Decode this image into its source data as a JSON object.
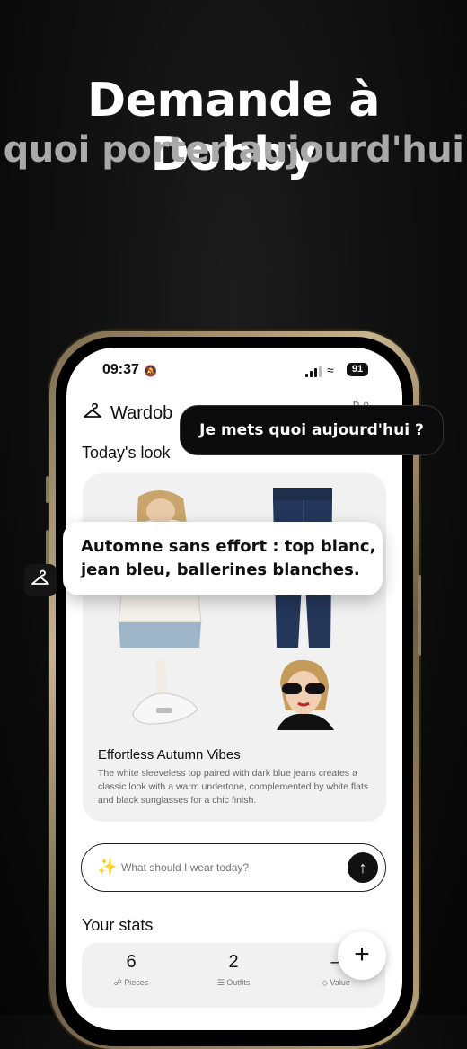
{
  "hero": {
    "title": "Demande à Dobby",
    "subtitle": "quoi porter aujourd'hui"
  },
  "status_bar": {
    "time": "09:37",
    "battery": "91"
  },
  "app": {
    "brand": "Wardob",
    "header_right": "₿ 0 ₀₀"
  },
  "todays_look": {
    "section_title": "Today's look",
    "title": "Effortless Autumn Vibes",
    "description": "The white sleeveless top paired with dark blue jeans creates a classic look with a warm undertone, complemented by white flats and black sunglasses for a chic finish."
  },
  "ask": {
    "placeholder": "What should I wear today?"
  },
  "stats": {
    "section_title": "Your stats",
    "items": [
      {
        "value": "6",
        "label": "Pieces"
      },
      {
        "value": "2",
        "label": "Outfits"
      },
      {
        "value": "–",
        "label": "Value"
      }
    ]
  },
  "chat": {
    "user_message": "Je mets quoi aujourd'hui ?",
    "assistant_message": "Automne sans effort : top blanc, jean bleu, ballerines blanches."
  },
  "icons": {
    "app_logo": "hanger-icon",
    "ask": "sparkles-icon",
    "send": "arrow-up-icon",
    "fab": "plus-icon",
    "pieces": "shirt-icon",
    "outfits": "layers-icon",
    "value": "tag-icon"
  },
  "colors": {
    "background": "#0b0b0b",
    "subtitle": "#a9a9a9",
    "phone_frame": "#c7b48c",
    "card": "#f1f1f1",
    "accent": "#111111"
  }
}
